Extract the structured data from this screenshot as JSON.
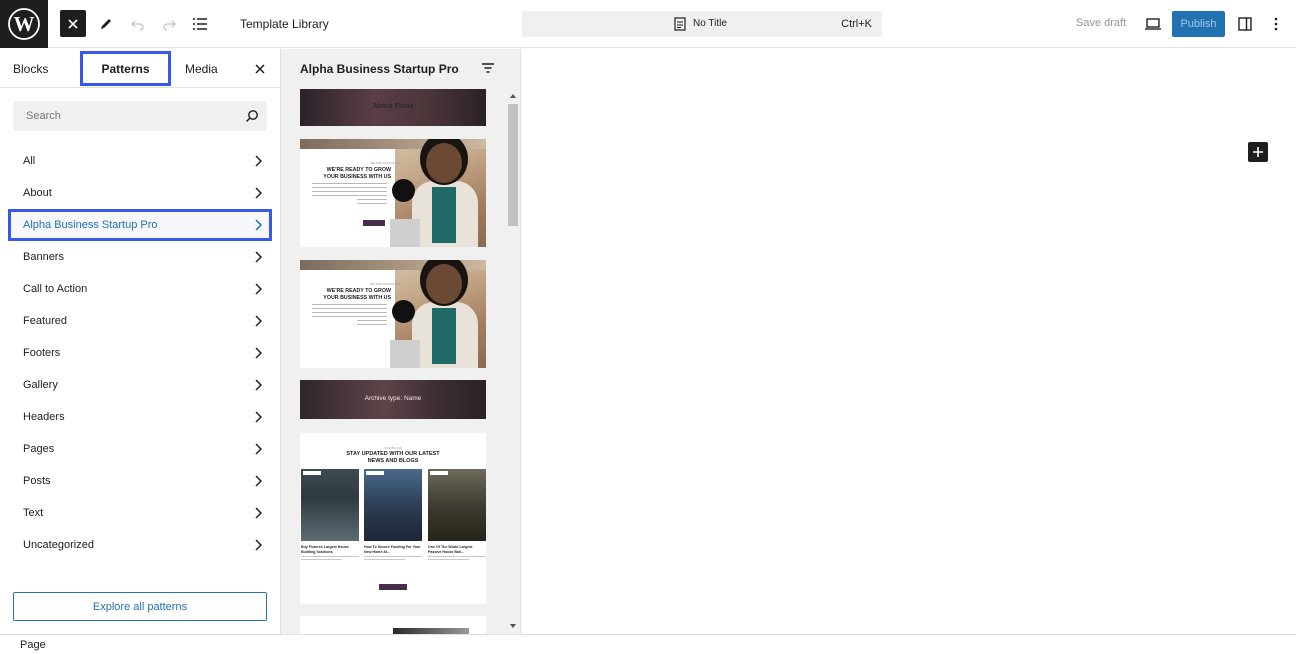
{
  "topbar": {
    "title": "Template Library",
    "command_title": "No Title",
    "command_shortcut": "Ctrl+K",
    "save_draft": "Save draft",
    "publish": "Publish"
  },
  "inserter": {
    "tabs": [
      {
        "label": "Blocks"
      },
      {
        "label": "Patterns",
        "selected": true
      },
      {
        "label": "Media"
      }
    ],
    "search_placeholder": "Search",
    "categories": [
      {
        "label": "All"
      },
      {
        "label": "About"
      },
      {
        "label": "Alpha Business Startup Pro",
        "selected": true
      },
      {
        "label": "Banners"
      },
      {
        "label": "Call to Action"
      },
      {
        "label": "Featured"
      },
      {
        "label": "Footers"
      },
      {
        "label": "Gallery"
      },
      {
        "label": "Headers"
      },
      {
        "label": "Pages"
      },
      {
        "label": "Posts"
      },
      {
        "label": "Text"
      },
      {
        "label": "Uncategorized"
      }
    ],
    "explore_button": "Explore all patterns"
  },
  "patterns_panel": {
    "title": "Alpha Business Startup Pro",
    "previews": {
      "header_label": "About Fiona",
      "hero_kicker": "WE ARE PASSIONATE",
      "hero_headline": "WE'RE READY TO GROW YOUR BUSINESS WITH US",
      "archive_label": "Archive type: Name",
      "blog_kicker": "OUR BLOGS",
      "blog_headline": "STAY UPDATED WITH OUR LATEST NEWS AND BLOGS",
      "posts": [
        {
          "title": "Buy Fixtures Largest House Building Solutions"
        },
        {
          "title": "How To Secure Funding For Your New Home At..."
        },
        {
          "title": "One Of The World Largest Passive House Buil..."
        }
      ]
    }
  },
  "footer": {
    "breadcrumb": "Page"
  },
  "colors": {
    "accent": "#3858e9",
    "link": "#2271b1",
    "dark": "#1e1e1e"
  }
}
